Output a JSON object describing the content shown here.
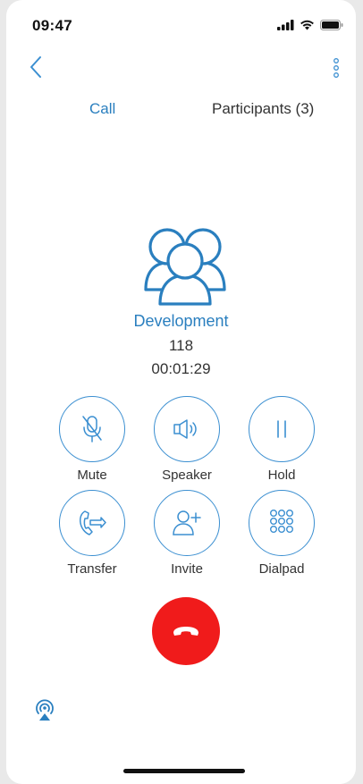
{
  "status": {
    "time": "09:47"
  },
  "tabs": {
    "call": "Call",
    "participants": "Participants (3)"
  },
  "call": {
    "name": "Development",
    "number": "118",
    "duration": "00:01:29"
  },
  "controls": {
    "mute": "Mute",
    "speaker": "Speaker",
    "hold": "Hold",
    "transfer": "Transfer",
    "invite": "Invite",
    "dialpad": "Dialpad"
  },
  "colors": {
    "accent": "#2a7fbf",
    "hangup": "#f01b1b"
  },
  "icons": [
    "back-icon",
    "more-icon",
    "group-icon",
    "mute-icon",
    "speaker-icon",
    "pause-icon",
    "transfer-icon",
    "add-user-icon",
    "dialpad-icon",
    "hangup-icon",
    "airplay-icon"
  ]
}
